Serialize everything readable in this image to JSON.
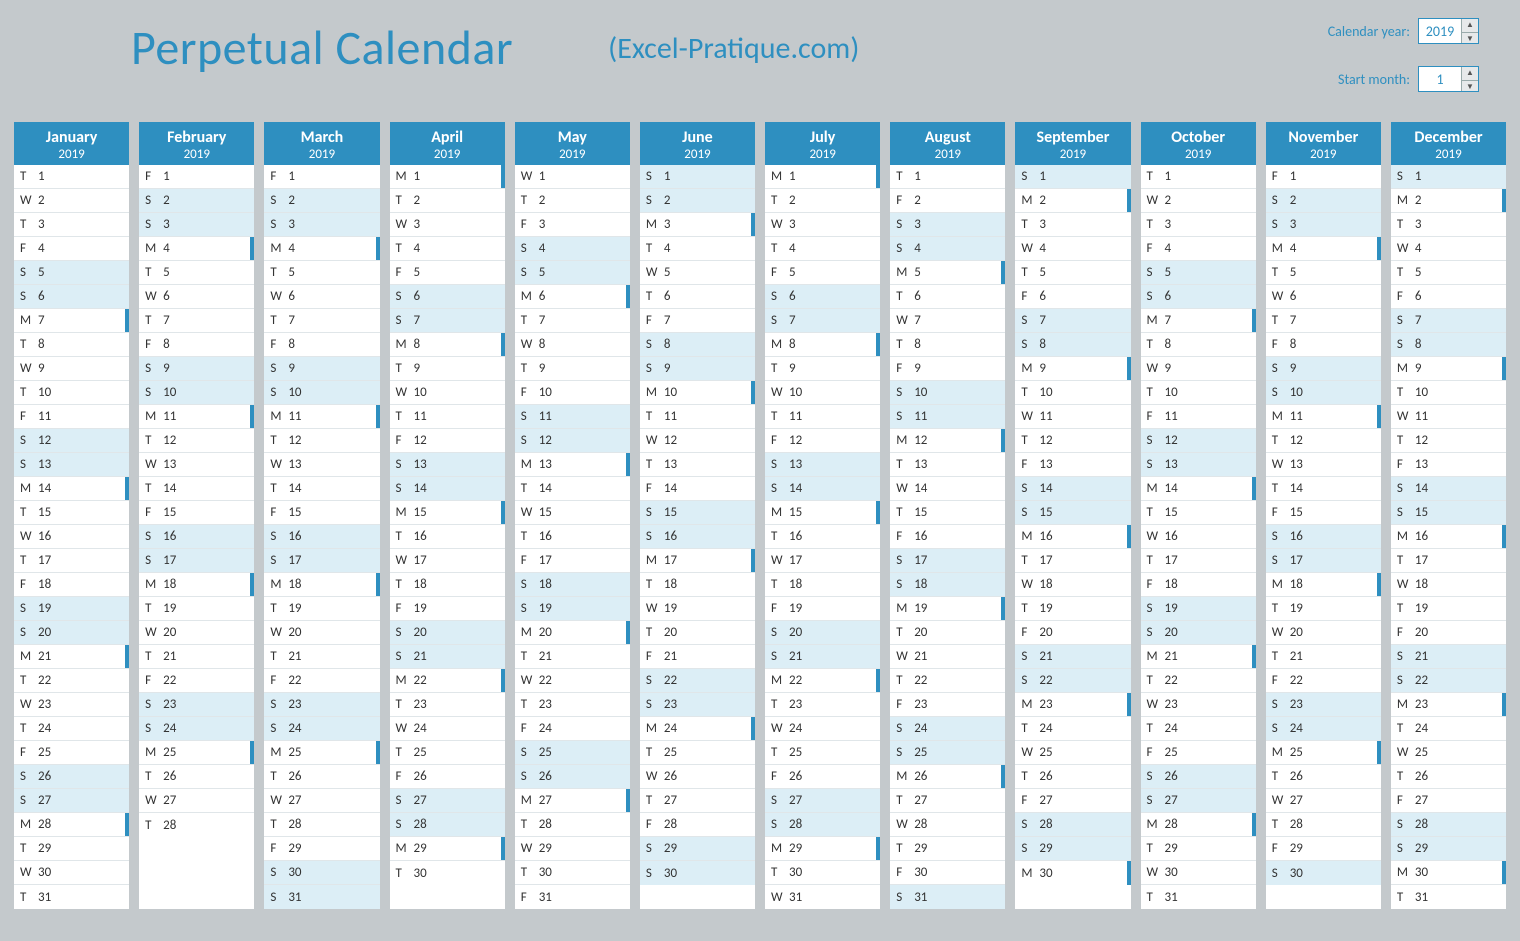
{
  "header": {
    "title": "Perpetual Calendar",
    "subtitle": "(Excel-Pratique.com)"
  },
  "controls": {
    "year_label": "Calendar year:",
    "year_value": "2019",
    "month_label": "Start month:",
    "month_value": "1"
  },
  "calendar": {
    "year": "2019",
    "start_month": 1,
    "dow_letters": [
      "S",
      "M",
      "T",
      "W",
      "T",
      "F",
      "S"
    ],
    "weekend_dows": [
      0,
      6
    ],
    "months": [
      {
        "name": "January",
        "days": 31,
        "first_dow": 2
      },
      {
        "name": "February",
        "days": 28,
        "first_dow": 5
      },
      {
        "name": "March",
        "days": 31,
        "first_dow": 5
      },
      {
        "name": "April",
        "days": 30,
        "first_dow": 1
      },
      {
        "name": "May",
        "days": 31,
        "first_dow": 3
      },
      {
        "name": "June",
        "days": 30,
        "first_dow": 6
      },
      {
        "name": "July",
        "days": 31,
        "first_dow": 1
      },
      {
        "name": "August",
        "days": 31,
        "first_dow": 4
      },
      {
        "name": "September",
        "days": 30,
        "first_dow": 0
      },
      {
        "name": "October",
        "days": 31,
        "first_dow": 2
      },
      {
        "name": "November",
        "days": 30,
        "first_dow": 5
      },
      {
        "name": "December",
        "days": 31,
        "first_dow": 0
      }
    ]
  }
}
